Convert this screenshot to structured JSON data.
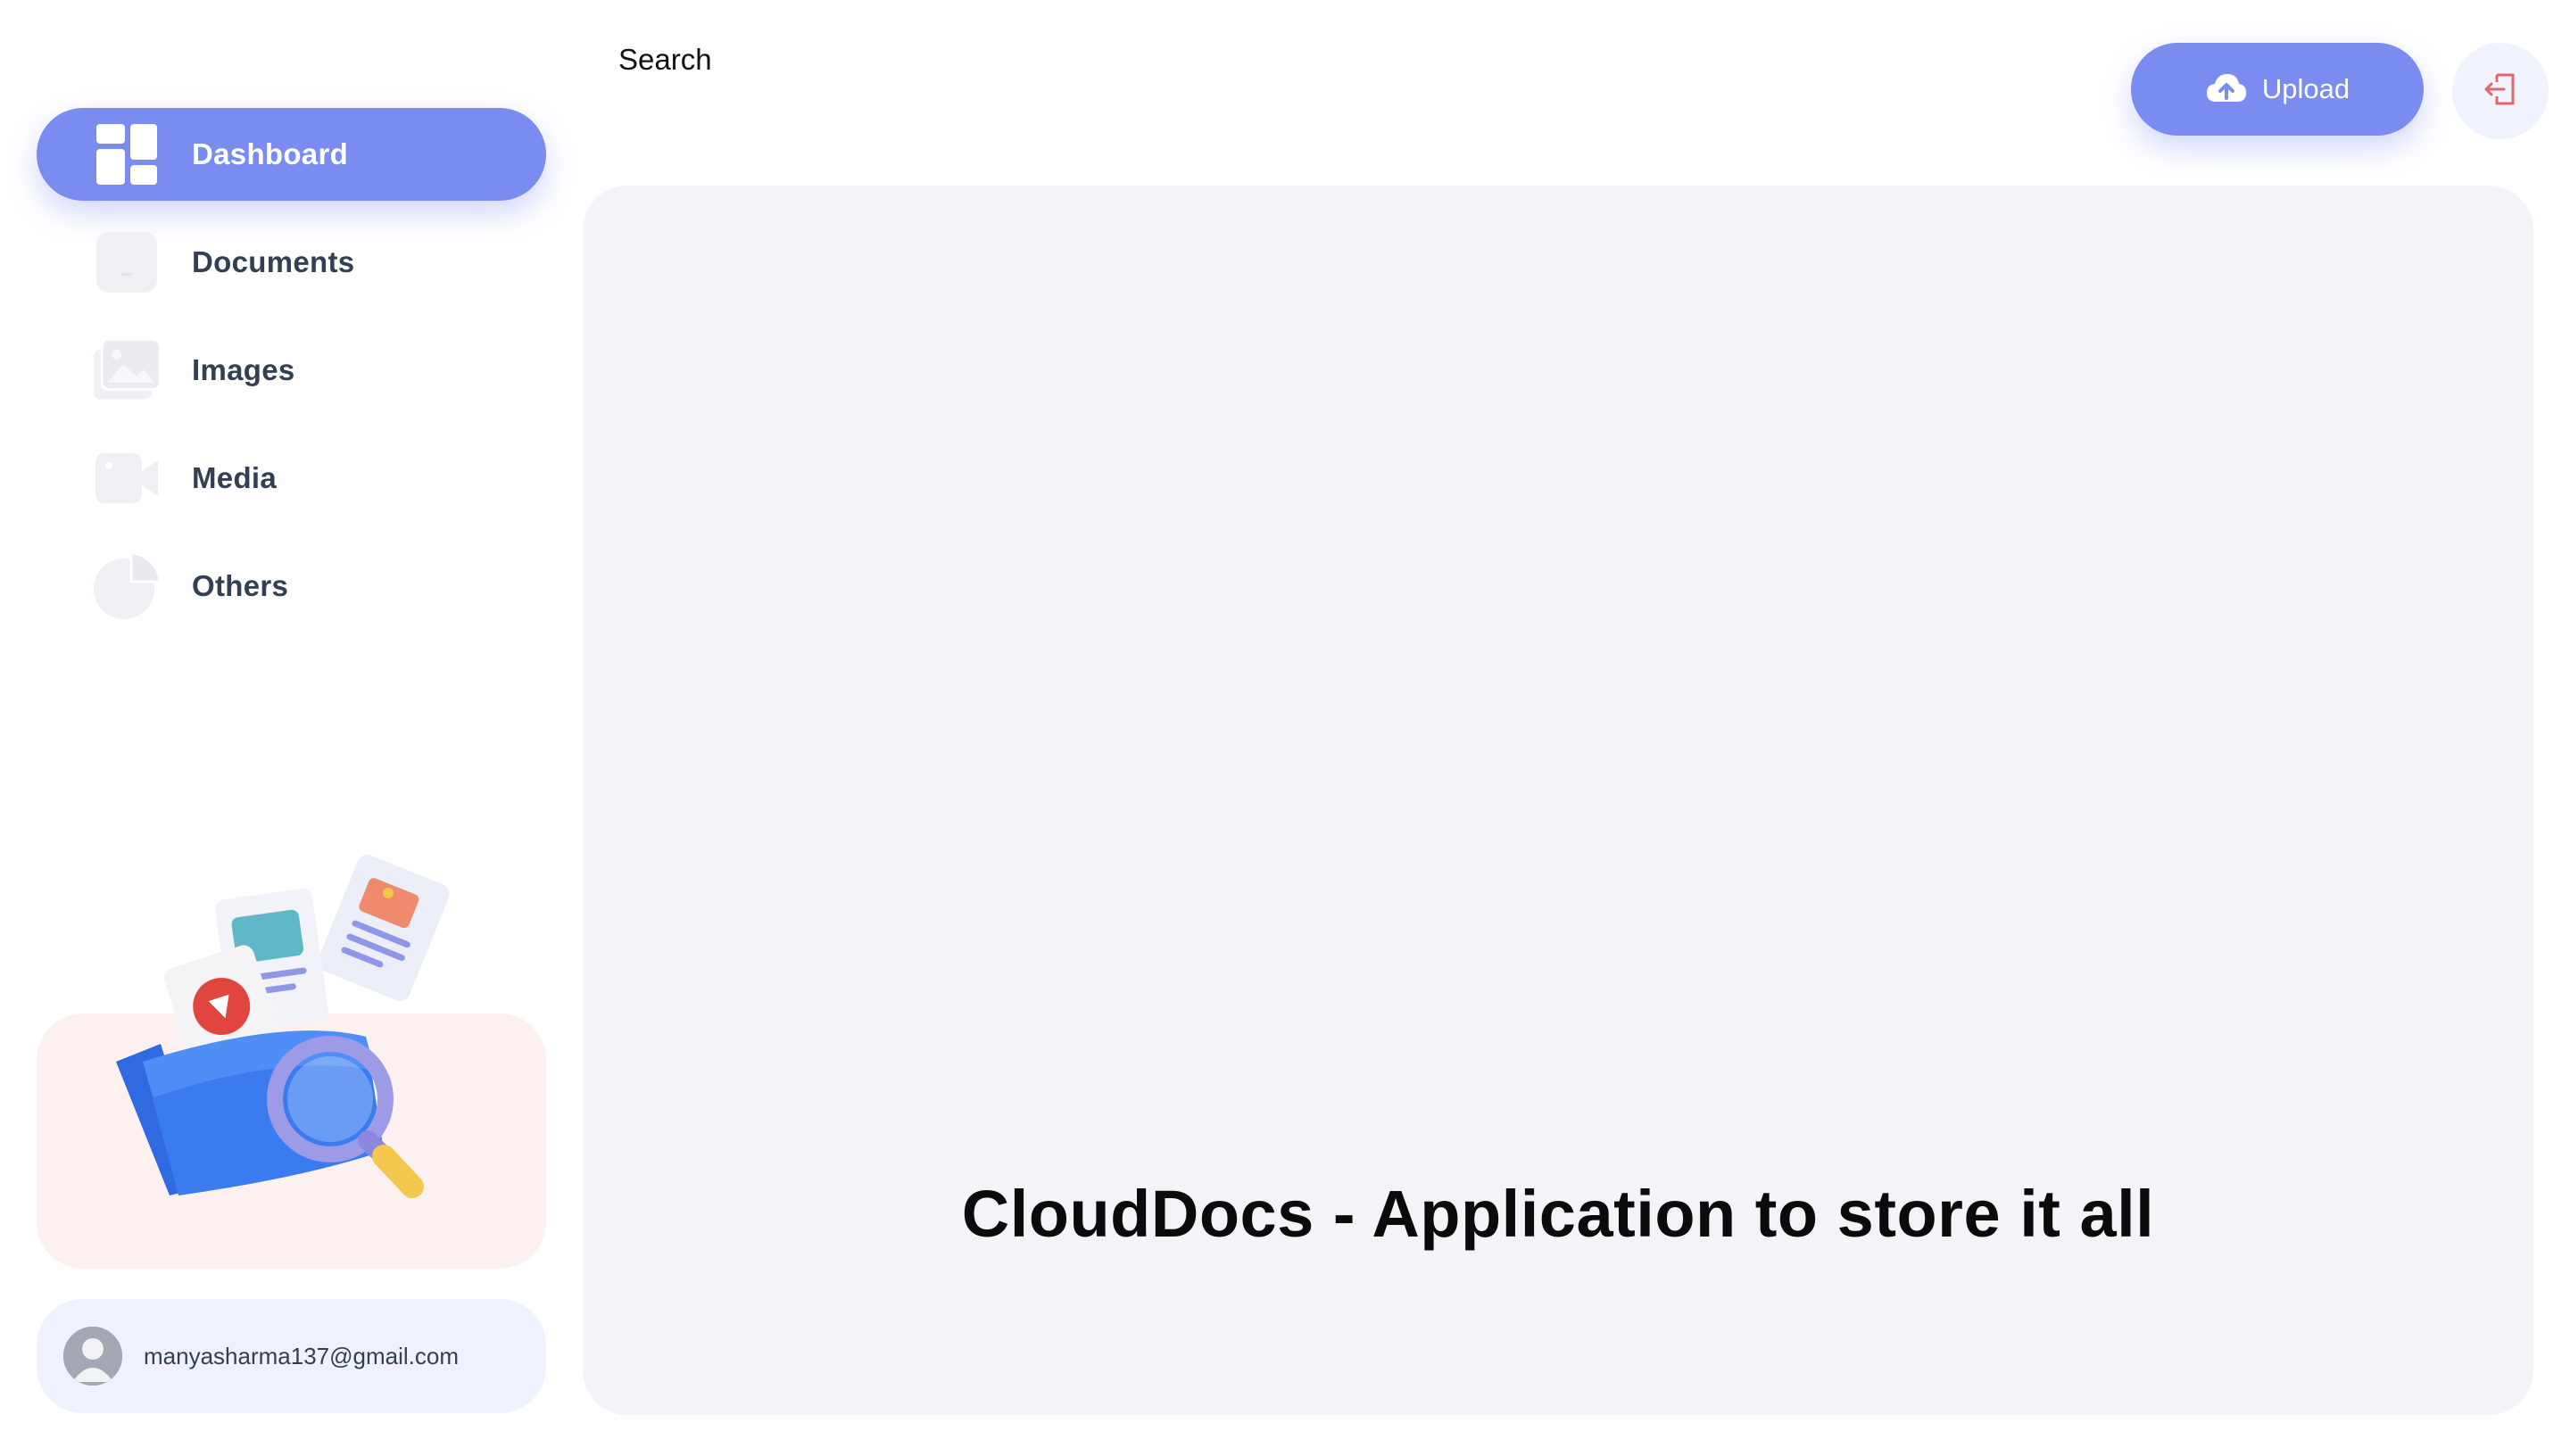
{
  "app": {
    "title": "CloudDocs - Application to store it all"
  },
  "header": {
    "search_label": "Search",
    "upload_label": "Upload",
    "upload_icon": "cloud-upload-icon",
    "logout_icon": "logout-icon"
  },
  "sidebar": {
    "items": [
      {
        "label": "Dashboard",
        "icon": "dashboard-icon",
        "active": true
      },
      {
        "label": "Documents",
        "icon": "document-icon",
        "active": false
      },
      {
        "label": "Images",
        "icon": "images-icon",
        "active": false
      },
      {
        "label": "Media",
        "icon": "video-icon",
        "active": false
      },
      {
        "label": "Others",
        "icon": "pie-chart-icon",
        "active": false
      }
    ]
  },
  "user": {
    "email": "manyasharma137@gmail.com"
  },
  "colors": {
    "accent": "#7b8cf0",
    "panel": "#f3f4f8",
    "illustration_card": "#fdf0f0",
    "user_card": "#eff2fe",
    "logout_icon": "#e1676f"
  }
}
